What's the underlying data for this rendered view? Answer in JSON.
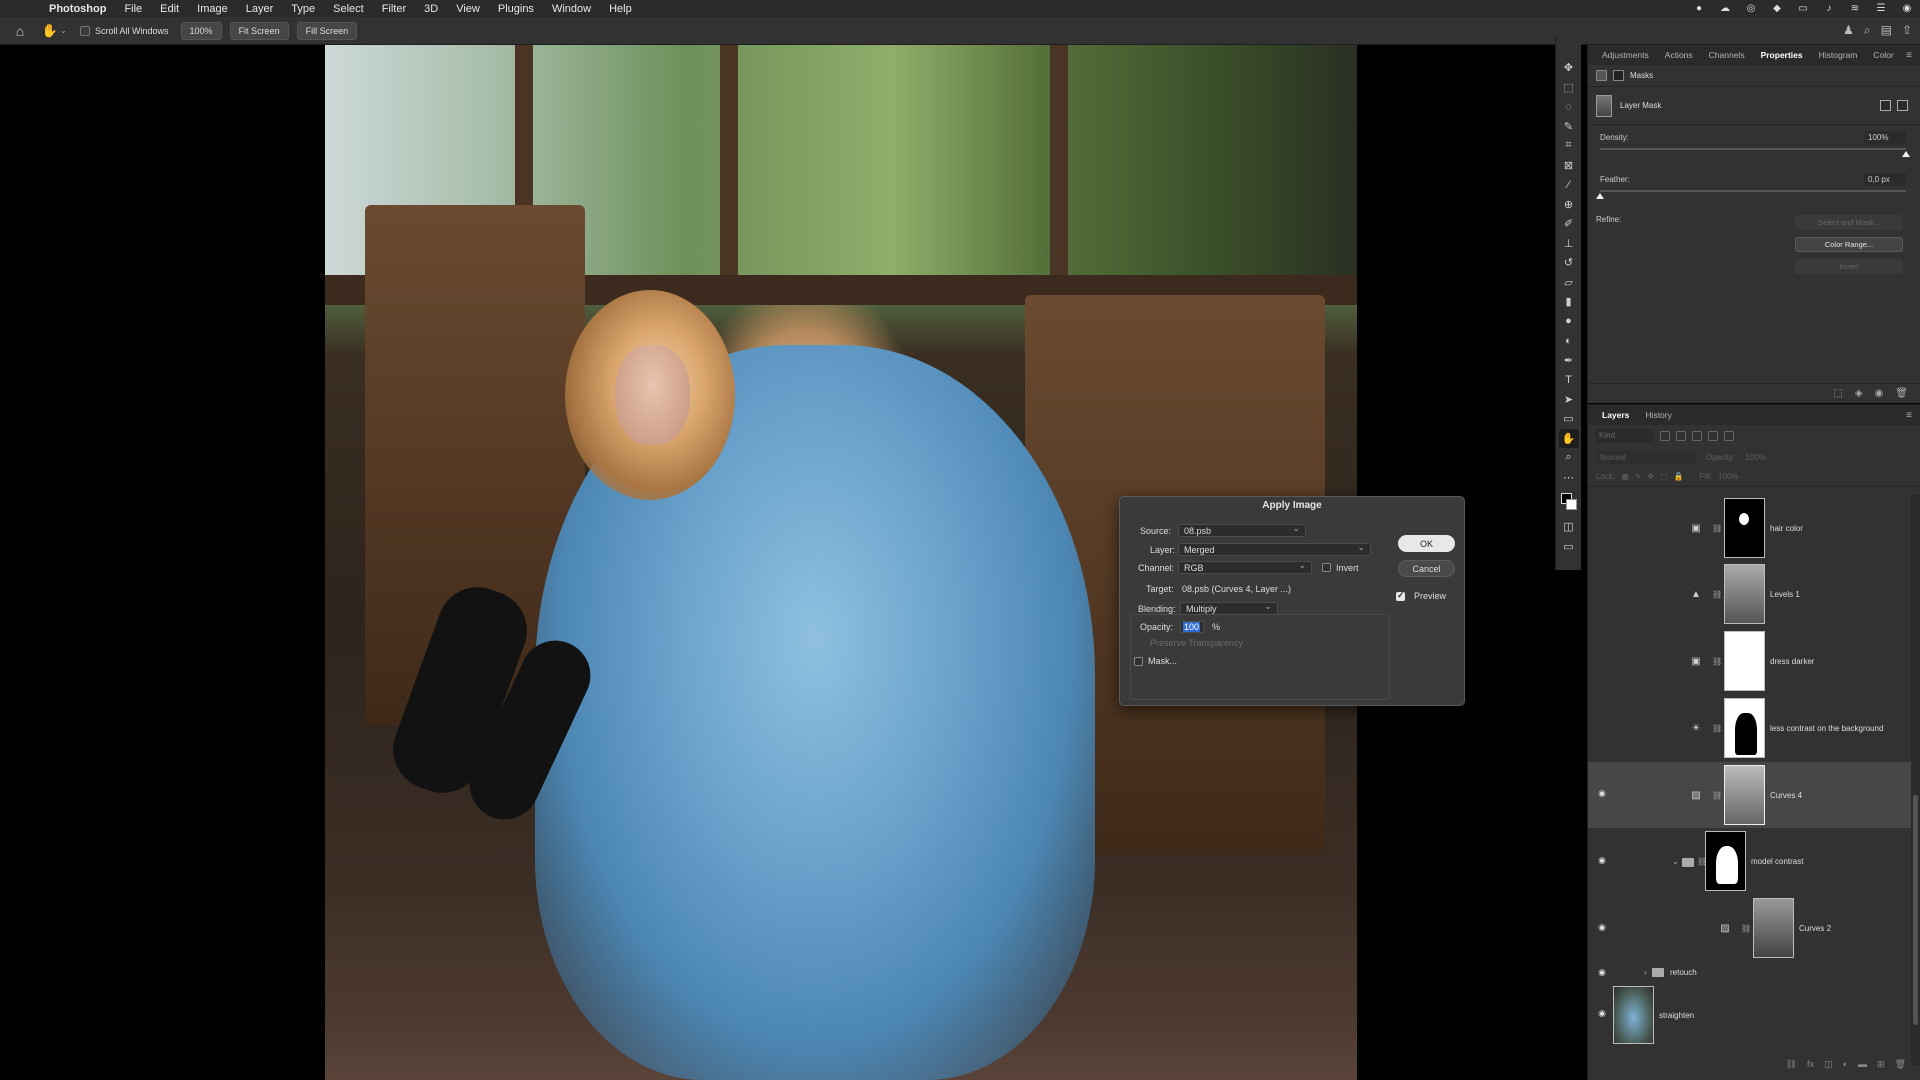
{
  "menubar": {
    "app": "Photoshop",
    "items": [
      "File",
      "Edit",
      "Image",
      "Layer",
      "Type",
      "Select",
      "Filter",
      "3D",
      "View",
      "Plugins",
      "Window",
      "Help"
    ]
  },
  "options_bar": {
    "scroll_all_windows": "Scroll All Windows",
    "zoom": "100%",
    "fit_screen": "Fit Screen",
    "fill_screen": "Fill Screen"
  },
  "properties_panel": {
    "tabs": [
      "Adjustments",
      "Actions",
      "Channels",
      "Properties",
      "Histogram",
      "Color"
    ],
    "active_tab": "Properties",
    "section": "Masks",
    "mask_type": "Layer Mask",
    "density_label": "Density:",
    "density_value": "100%",
    "density_fraction": 1.0,
    "feather_label": "Feather:",
    "feather_value": "0,0 px",
    "feather_fraction": 0.0,
    "refine_label": "Refine:",
    "select_and_mask": "Select and Mask...",
    "color_range": "Color Range...",
    "invert": "Invert"
  },
  "layers_panel": {
    "tabs": [
      "Layers",
      "History"
    ],
    "active_tab": "Layers",
    "kind_placeholder": "Kind",
    "blend_mode": "Normal",
    "opacity_label": "Opacity:",
    "opacity_value": "100%",
    "lock_label": "Lock:",
    "fill_label": "Fill:",
    "fill_value": "100%",
    "layers": [
      {
        "name": "hair color",
        "visible": false,
        "selected": false,
        "adjustment": "hue-saturation-icon"
      },
      {
        "name": "Levels 1",
        "visible": false,
        "selected": false,
        "adjustment": "levels-icon"
      },
      {
        "name": "dress darker",
        "visible": false,
        "selected": false,
        "adjustment": "hue-saturation-icon"
      },
      {
        "name": "less contrast on the background",
        "visible": false,
        "selected": false,
        "adjustment": "brightness-contrast-icon"
      },
      {
        "name": "Curves 4",
        "visible": true,
        "selected": true,
        "adjustment": "curves-icon"
      },
      {
        "name": "model contrast",
        "visible": true,
        "selected": false,
        "adjustment": "group-folder-icon"
      },
      {
        "name": "Curves 2",
        "visible": true,
        "selected": false,
        "adjustment": "curves-icon"
      },
      {
        "name": "retouch",
        "visible": true,
        "selected": false,
        "adjustment": "folder-icon"
      },
      {
        "name": "straighten",
        "visible": true,
        "selected": false,
        "adjustment": "image-thumbnail"
      }
    ]
  },
  "apply_image_dialog": {
    "title": "Apply Image",
    "source_label": "Source:",
    "source_value": "08.psb",
    "layer_label": "Layer:",
    "layer_value": "Merged",
    "channel_label": "Channel:",
    "channel_value": "RGB",
    "invert_label": "Invert",
    "invert_checked": false,
    "target_label": "Target:",
    "target_value": "08.psb (Curves 4, Layer ...)",
    "blending_label": "Blending:",
    "blending_value": "Multiply",
    "opacity_label": "Opacity:",
    "opacity_value": "100",
    "opacity_unit": "%",
    "preserve_transparency": "Preserve Transparency",
    "mask_label": "Mask...",
    "mask_checked": false,
    "ok": "OK",
    "cancel": "Cancel",
    "preview_label": "Preview",
    "preview_checked": true
  },
  "colors": {
    "panel_bg": "#323232",
    "dialog_bg": "#3a3a3a",
    "selection_blue": "#2f6cd6"
  }
}
